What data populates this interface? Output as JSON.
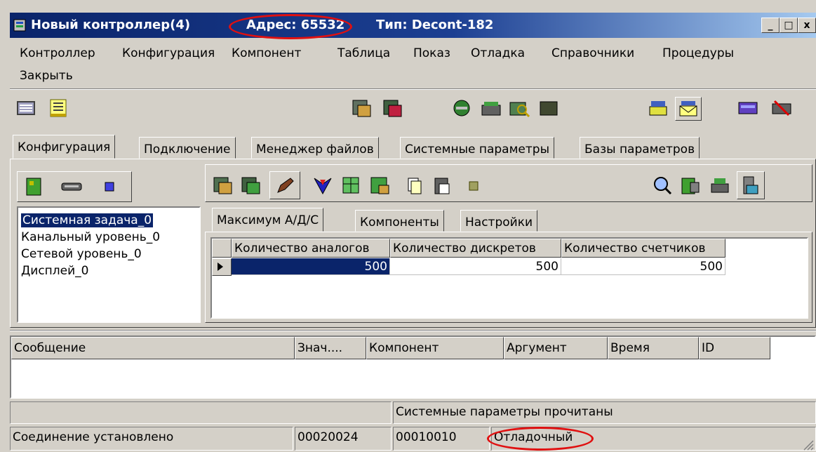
{
  "window": {
    "title": "Новый контроллер(4)",
    "address": "Адрес: 65532",
    "type": "Тип: Decont-182",
    "minimize_label": "_",
    "maximize_label": "□",
    "close_label": "x"
  },
  "menu": [
    "Контроллер",
    "Конфигурация",
    "Компонент",
    "Таблица",
    "Показ",
    "Отладка",
    "Справочники",
    "Процедуры",
    "Закрыть"
  ],
  "main_tabs": [
    "Конфигурация",
    "Подключение",
    "Менеджер файлов",
    "Системные параметры",
    "Базы параметров"
  ],
  "tree": {
    "items": [
      "Системная задача_0",
      "Канальный уровень_0",
      "Сетевой уровень_0",
      "Дисплей_0"
    ],
    "selected_index": 0
  },
  "sub_tabs": [
    "Максимум А/Д/С",
    "Компоненты",
    "Настройки"
  ],
  "grid": {
    "columns": [
      "Количество аналогов",
      "Количество дискретов",
      "Количество счетчиков"
    ],
    "rows": [
      [
        "500",
        "500",
        "500"
      ]
    ]
  },
  "messages": {
    "columns": [
      "Сообщение",
      "Знач....",
      "Компонент",
      "Аргумент",
      "Время",
      "ID"
    ]
  },
  "status": {
    "info": "Системные параметры прочитаны",
    "connection": "Соединение установлено",
    "code1": "00020024",
    "code2": "00010010",
    "mode": "Отладочный"
  },
  "colors": {
    "title_bar": "#0a246a",
    "face": "#d4d0c8",
    "selection": "#0a246a",
    "highlight_oval": "#e01010"
  }
}
